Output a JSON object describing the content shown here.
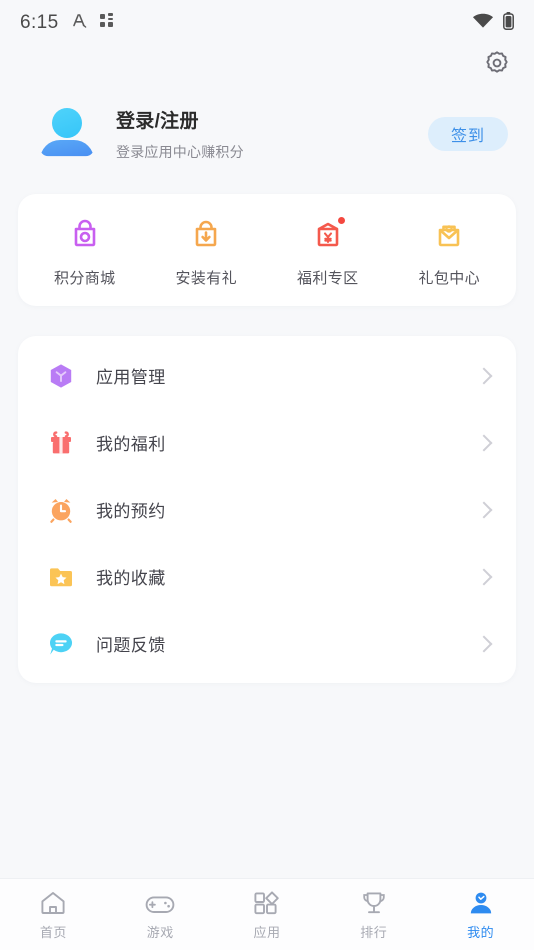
{
  "status_bar": {
    "time": "6:15",
    "left_icons": [
      "a-pencil-icon",
      "app-grid-icon"
    ],
    "right_icons": [
      "wifi-icon",
      "battery-icon"
    ]
  },
  "header": {
    "settings_icon": "gear-icon"
  },
  "profile": {
    "avatar_icon": "user-avatar",
    "title": "登录/注册",
    "subtitle": "登录应用中心赚积分",
    "signin_label": "签到",
    "signin_bg": "#ddeefc",
    "signin_color": "#3d90e8"
  },
  "quick_actions": [
    {
      "label": "积分商城",
      "icon": "shopping-bag-icon",
      "color": "#c85ff0",
      "badge": false
    },
    {
      "label": "安装有礼",
      "icon": "download-bag-icon",
      "color": "#f5a council",
      "badge": false
    },
    {
      "label": "福利专区",
      "icon": "red-envelope-yuan-icon",
      "color": "#f4594c",
      "badge": true
    },
    {
      "label": "礼包中心",
      "icon": "gift-envelope-icon",
      "color": "#f8c254",
      "badge": false
    }
  ],
  "menu_items": [
    {
      "label": "应用管理",
      "icon": "app-cube-icon",
      "color": "#b97cf5"
    },
    {
      "label": "我的福利",
      "icon": "gift-box-icon",
      "color": "#f96e6e"
    },
    {
      "label": "我的预约",
      "icon": "alarm-clock-icon",
      "color": "#fba45f"
    },
    {
      "label": "我的收藏",
      "icon": "folder-star-icon",
      "color": "#fbc council"
    },
    {
      "label": "问题反馈",
      "icon": "chat-bubble-icon",
      "color": "#4dd2f5"
    }
  ],
  "tabs": [
    {
      "label": "首页",
      "icon": "home-icon",
      "active": false
    },
    {
      "label": "游戏",
      "icon": "gamepad-icon",
      "active": false
    },
    {
      "label": "应用",
      "icon": "app-grid-icon",
      "active": false
    },
    {
      "label": "排行",
      "icon": "trophy-icon",
      "active": false
    },
    {
      "label": "我的",
      "icon": "person-icon",
      "active": true
    }
  ],
  "theme": {
    "page_bg": "#f7f8fa",
    "card_bg": "#ffffff",
    "accent": "#2e8bf0",
    "inactive": "#a7a9b2"
  }
}
